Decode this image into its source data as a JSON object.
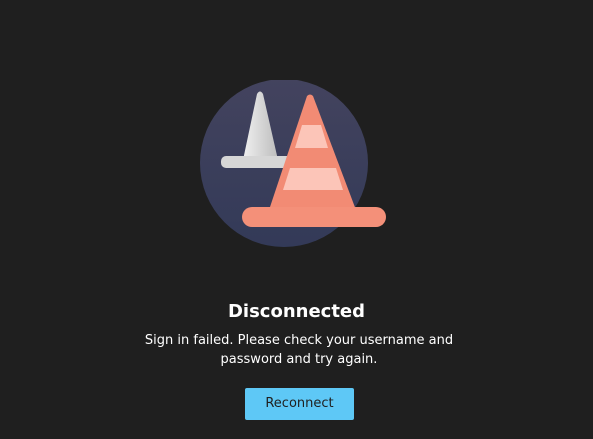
{
  "illustration": {
    "icon": "traffic-cones-icon",
    "colors": {
      "circle": "#3b3f5c",
      "cone_front": "#f28b74",
      "cone_front_stripe": "#fcc5b8",
      "cone_back": "#d9d9d9"
    }
  },
  "status": {
    "title": "Disconnected",
    "message": "Sign in failed. Please check your username and password and try again."
  },
  "actions": {
    "reconnect_label": "Reconnect",
    "accent": "#5ec8f6"
  }
}
